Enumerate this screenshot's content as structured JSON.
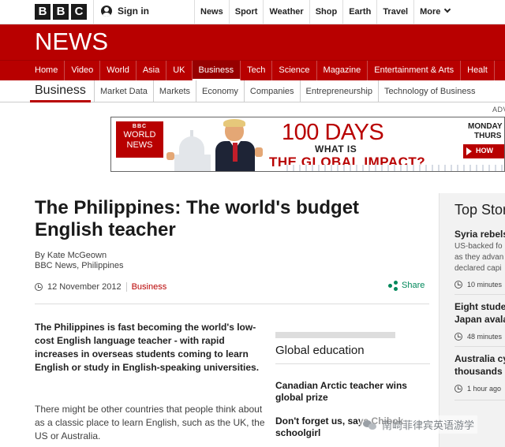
{
  "brand": {
    "letters": [
      "B",
      "B",
      "C"
    ]
  },
  "account": {
    "signin": "Sign in"
  },
  "top_nav": [
    "News",
    "Sport",
    "Weather",
    "Shop",
    "Earth",
    "Travel",
    "More"
  ],
  "banner": {
    "title": "NEWS"
  },
  "news_nav": [
    "Home",
    "Video",
    "World",
    "Asia",
    "UK",
    "Business",
    "Tech",
    "Science",
    "Magazine",
    "Entertainment & Arts",
    "Healt"
  ],
  "news_nav_active": "Business",
  "section_nav": {
    "title": "Business",
    "items": [
      "Market Data",
      "Markets",
      "Economy",
      "Companies",
      "Entrepreneurship",
      "Technology of Business"
    ]
  },
  "advert": {
    "label": "ADV",
    "logo": {
      "bbc": "BBC",
      "lines": [
        "WORLD",
        "NEWS"
      ]
    },
    "big": "100 DAYS",
    "mid": "WHAT IS",
    "bottom": "THE GLOBAL IMPACT?",
    "right_line1": "MONDAY",
    "right_line2": "THURS",
    "button": "HOW"
  },
  "article": {
    "headline": "The Philippines: The world's budget English teacher",
    "author": "By Kate McGeown",
    "outlet": "BBC News, Philippines",
    "date": "12 November 2012",
    "tag": "Business",
    "share": "Share",
    "intro": "The Philippines is fast becoming the world's low-cost English language teacher - with rapid increases in overseas students coming to learn English or study in English-speaking universities.",
    "paragraph": "There might be other countries that people think about as a classic place to learn English, such as the UK, the US or Australia."
  },
  "global_education": {
    "title": "Global education",
    "items": [
      "Canadian Arctic teacher wins global prize",
      "Don't forget us, says Chibok schoolgirl"
    ]
  },
  "top_stories": {
    "title": "Top Stor",
    "items": [
      {
        "headline": "Syria rebels",
        "desc": [
          "US-backed fo",
          "as they advan",
          "declared capi"
        ],
        "time": "10 minutes"
      },
      {
        "headline": [
          "Eight stude",
          "Japan avala"
        ],
        "time": "48 minutes"
      },
      {
        "headline": [
          "Australia cy",
          "thousands"
        ],
        "time": "1 hour ago"
      }
    ]
  },
  "watermark": {
    "text": "南崎菲律宾英语游学"
  },
  "colors": {
    "bbc_red": "#b80000",
    "share_green": "#00885a"
  }
}
